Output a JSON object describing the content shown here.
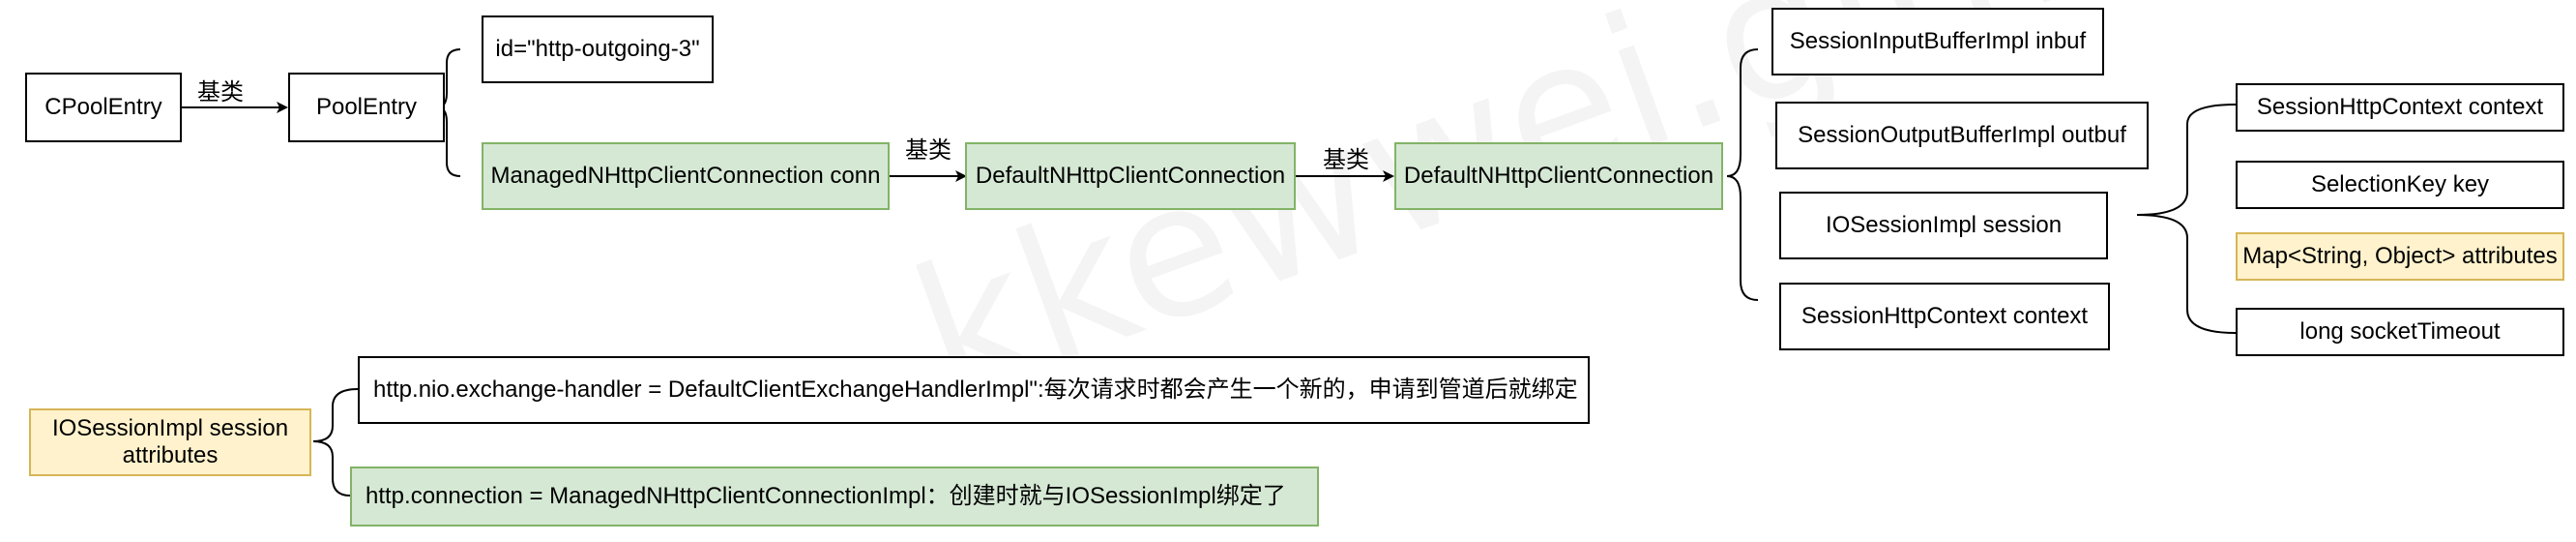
{
  "watermark": "kkewwei.github.io",
  "colors": {
    "green_fill": "#d5e8d4",
    "green_stroke": "#82b366",
    "yellow_fill": "#fff2cc",
    "yellow_stroke": "#d6b656"
  },
  "nodes": {
    "cpool_entry": "CPoolEntry",
    "pool_entry": "PoolEntry",
    "id_attr": "id=\"http-outgoing-3\"",
    "managed_conn": "ManagedNHttpClientConnection conn",
    "default_conn_1": "DefaultNHttpClientConnection",
    "default_conn_2": "DefaultNHttpClientConnection",
    "inbuf": "SessionInputBufferImpl inbuf",
    "outbuf": "SessionOutputBufferImpl outbuf",
    "iosession": "IOSessionImpl session",
    "http_context": "SessionHttpContext context",
    "session_http_context": "SessionHttpContext context",
    "selection_key": "SelectionKey key",
    "attributes_map": "Map<String, Object> attributes",
    "socket_timeout": "long socketTimeout",
    "iosession_attributes": "IOSessionImpl session attributes",
    "exchange_handler": "http.nio.exchange-handler = DefaultClientExchangeHandlerImpl\":每次请求时都会产生一个新的，申请到管道后就绑定",
    "http_connection": "http.connection = ManagedNHttpClientConnectionImpl：创建时就与IOSessionImpl绑定了"
  },
  "edge_labels": {
    "cpool_to_pool": "基类",
    "managed_to_default": "基类",
    "default_to_default": "基类"
  }
}
